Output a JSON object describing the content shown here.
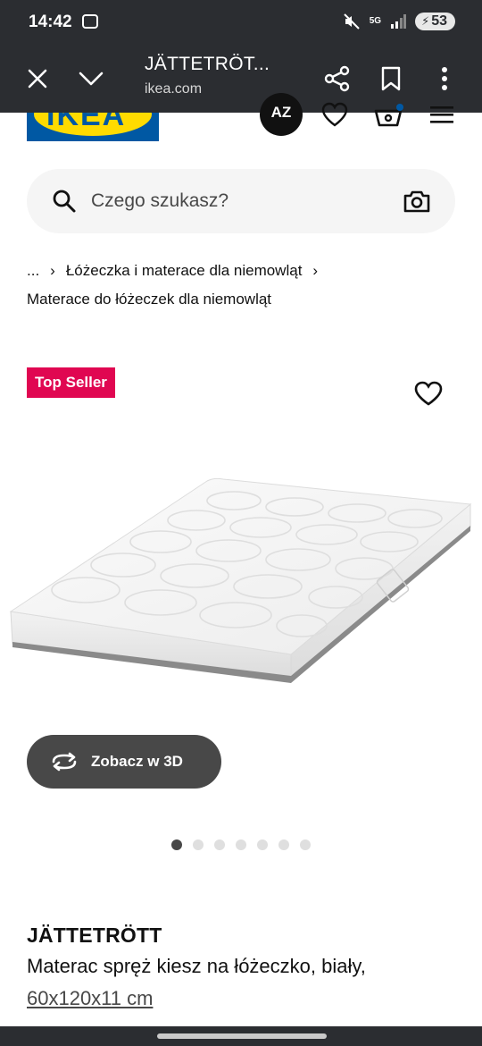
{
  "status_bar": {
    "time": "14:42",
    "network": "5G",
    "battery": "53"
  },
  "browser": {
    "title": "JÄTTETRÖT...",
    "url": "ikea.com"
  },
  "header": {
    "logo_text": "IKEA",
    "avatar_initials": "AZ"
  },
  "search": {
    "placeholder": "Czego szukasz?"
  },
  "breadcrumb": {
    "ellipsis": "...",
    "items": [
      "Łóżeczka i materace dla niemowląt",
      "Materace do łóżeczek dla niemowląt"
    ]
  },
  "product": {
    "badge": "Top Seller",
    "view3d_label": "Zobacz w 3D",
    "name": "JÄTTETRÖTT",
    "description": "Materac spręż kiesz na łóżeczko, biały,",
    "size": "60x120x11 cm",
    "image_count": 7,
    "active_image": 1
  },
  "colors": {
    "chrome": "#2b2d31",
    "ikea_blue": "#0058a3",
    "ikea_yellow": "#ffdb00",
    "badge_red": "#e00751",
    "button_gray": "#484848"
  }
}
